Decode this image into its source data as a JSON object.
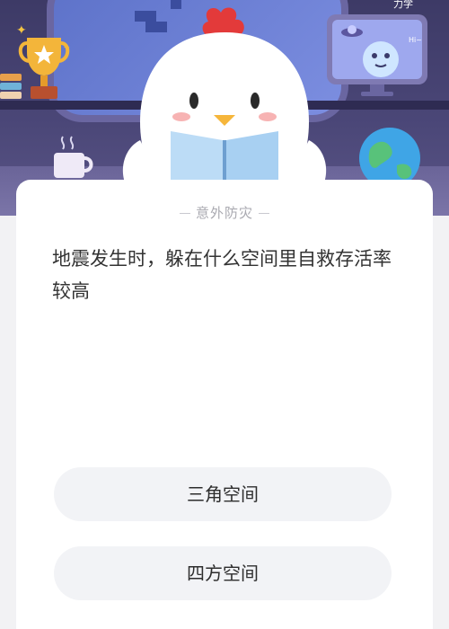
{
  "header": {
    "corner_text": "力学",
    "monitor_text": "Hi~"
  },
  "quiz": {
    "category": "意外防灾",
    "question": "地震发生时，躲在什么空间里自救存活率较高",
    "options": [
      {
        "label": "三角空间"
      },
      {
        "label": "四方空间"
      }
    ]
  },
  "colors": {
    "scene_background": "#4a4677",
    "card_background": "#ffffff",
    "option_background": "#f2f3f6",
    "chick_crest": "#e33a3a"
  },
  "icons": [
    "trophy-icon",
    "books-icon",
    "monitor-icon",
    "globe-icon",
    "mug-icon",
    "chick-mascot"
  ]
}
